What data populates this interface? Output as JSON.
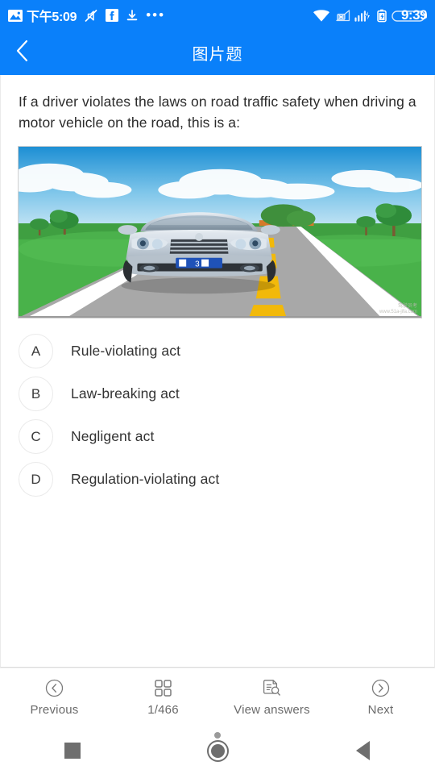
{
  "statusbar": {
    "time": "下午5:09",
    "clock": "9:39",
    "icons_left": [
      "image-icon",
      "mute-icon",
      "facebook-icon",
      "download-icon",
      "overflow-dots-icon"
    ],
    "icons_right": [
      "wifi-icon",
      "no-signal-icon",
      "signal-charging-icon",
      "battery-icon"
    ],
    "overflow": "•••",
    "background": "#0a80fa",
    "foreground": "#ffffff"
  },
  "header": {
    "title": "图片题",
    "back_icon": "chevron-left-icon",
    "background": "#0a80fa"
  },
  "question": {
    "text": "If a driver violates the laws on road traffic safety when driving a motor vehicle on the road, this is a:"
  },
  "figure": {
    "alt": "Illustration of a silver sedan driving on a road with a yellow dashed center line, grass and trees on both sides under a blue sky",
    "watermark_line1": "驾驶员考",
    "watermark_line2": "www.51a-jifa.com",
    "plate_text": "B 3"
  },
  "options": [
    {
      "key": "A",
      "label": "Rule‑violating act"
    },
    {
      "key": "B",
      "label": "Law‑breaking act"
    },
    {
      "key": "C",
      "label": "Negligent act"
    },
    {
      "key": "D",
      "label": "Regulation‑violating act"
    }
  ],
  "toolbar": {
    "previous_label": "Previous",
    "previous_icon": "circle-chevron-left-icon",
    "counter_label": "1/466",
    "counter_icon": "grid-icon",
    "view_answers_label": "View answers",
    "view_answers_icon": "document-search-icon",
    "next_label": "Next",
    "next_icon": "circle-chevron-right-icon"
  },
  "navbar": {
    "recents": "square-recents-icon",
    "home": "circle-home-icon",
    "back": "triangle-back-icon"
  }
}
